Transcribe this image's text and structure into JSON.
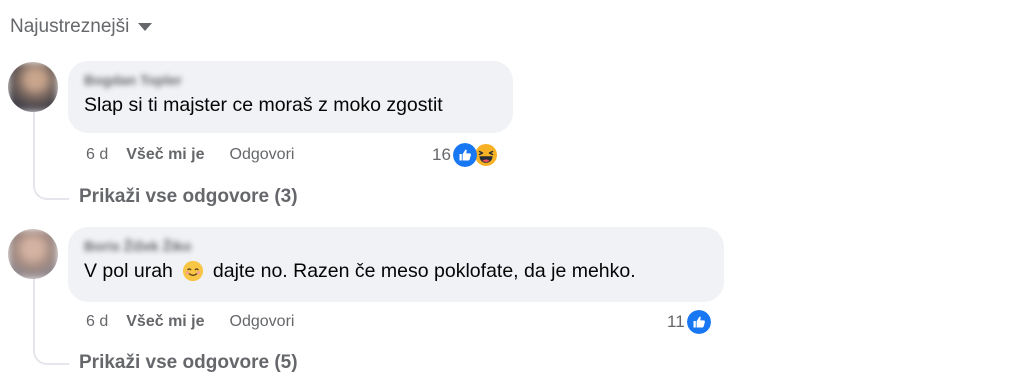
{
  "sort": {
    "label": "Najustreznejši"
  },
  "comments": [
    {
      "author": "Bogdan Topler",
      "text": "Slap si ti majster ce moraš z moko zgostit",
      "time": "6 d",
      "like_label": "Všeč mi je",
      "reply_label": "Odgovori",
      "reaction_count": "16",
      "reactions": [
        "like-icon",
        "laughing-face-icon"
      ],
      "show_replies": "Prikaži vse odgovore (3)"
    },
    {
      "author": "Boris Žižek Žiko",
      "text_before": "V pol urah",
      "text_emoji": "smiling-face-icon",
      "text_after": "dajte no. Razen če meso poklofate, da je mehko.",
      "time": "6 d",
      "like_label": "Všeč mi je",
      "reply_label": "Odgovori",
      "reaction_count": "11",
      "reactions": [
        "like-icon"
      ],
      "show_replies": "Prikaži vse odgovore (5)"
    }
  ],
  "colors": {
    "bubble": "#f0f2f5",
    "meta_text": "#65676b",
    "like_blue": "#1877f2",
    "emoji_yellow": "#f7b125"
  }
}
